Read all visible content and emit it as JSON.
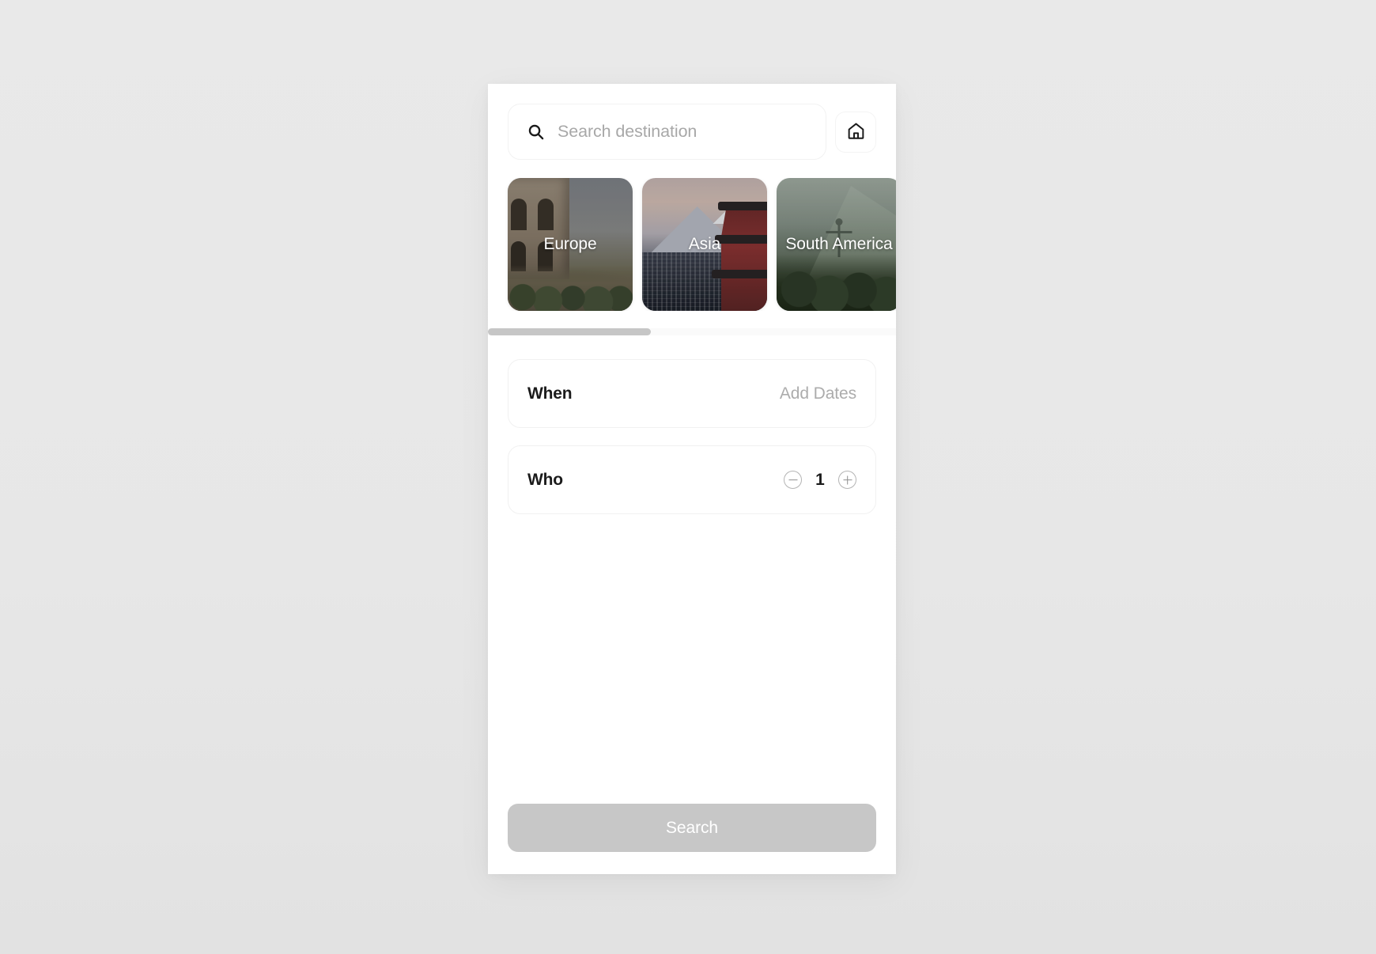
{
  "search": {
    "placeholder": "Search destination",
    "value": "",
    "icon": "search-icon",
    "home_button_icon": "home-icon"
  },
  "destinations": {
    "cards": [
      {
        "label": "Europe",
        "image": "colosseum-rome-photo"
      },
      {
        "label": "Asia",
        "image": "mount-fuji-pagoda-photo"
      },
      {
        "label": "South America",
        "image": "christ-the-redeemer-photo"
      }
    ],
    "scroll_position_percent": 0,
    "scroll_thumb_width_percent": 40
  },
  "options": [
    {
      "label": "When",
      "value": "Add Dates",
      "type": "text"
    },
    {
      "label": "Who",
      "value": "1",
      "type": "stepper",
      "decrement_icon": "minus-circle-icon",
      "increment_icon": "plus-circle-icon"
    }
  ],
  "footer": {
    "search_label": "Search"
  },
  "colors": {
    "page_background": "#e8e8e8",
    "panel_background": "#ffffff",
    "primary_text": "#1b1b1b",
    "muted_text": "#acacac",
    "placeholder_text": "#a8a8a8",
    "button_disabled": "#c7c7c7",
    "button_text": "#ffffff",
    "scrollbar_thumb": "#c6c6c6",
    "scrollbar_track": "#fafafa",
    "card_label": "#ffffff"
  }
}
